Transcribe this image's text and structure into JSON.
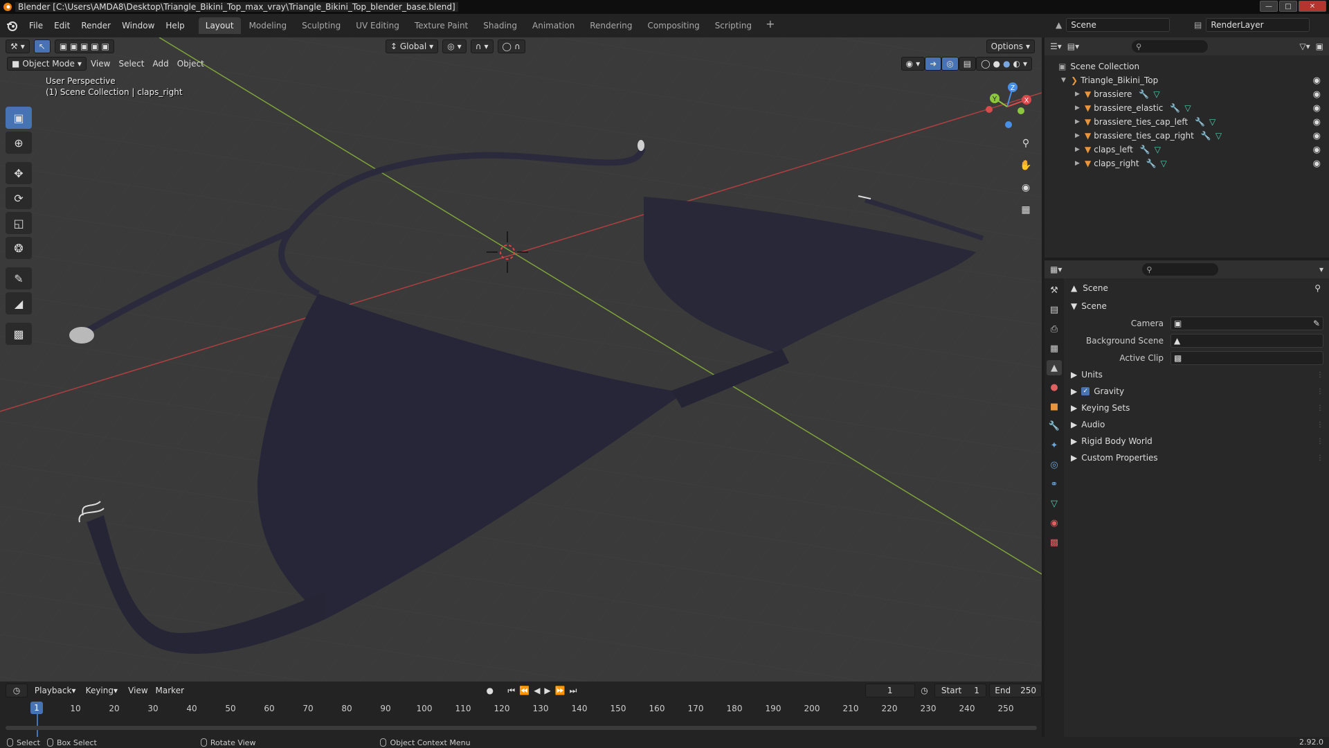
{
  "window": {
    "title": "Blender [C:\\Users\\AMDA8\\Desktop\\Triangle_Bikini_Top_max_vray\\Triangle_Bikini_Top_blender_base.blend]"
  },
  "menu": {
    "file": "File",
    "edit": "Edit",
    "render": "Render",
    "window": "Window",
    "help": "Help"
  },
  "workspaces": [
    {
      "label": "Layout",
      "active": true
    },
    {
      "label": "Modeling"
    },
    {
      "label": "Sculpting"
    },
    {
      "label": "UV Editing"
    },
    {
      "label": "Texture Paint"
    },
    {
      "label": "Shading"
    },
    {
      "label": "Animation"
    },
    {
      "label": "Rendering"
    },
    {
      "label": "Compositing"
    },
    {
      "label": "Scripting"
    }
  ],
  "scene_name": "Scene",
  "view_layer": "RenderLayer",
  "viewport": {
    "transform_orientation": "Global",
    "options_label": "Options",
    "mode": "Object Mode",
    "menus": {
      "view": "View",
      "select": "Select",
      "add": "Add",
      "object": "Object"
    },
    "perspective_label": "User Perspective",
    "collection_label": "(1) Scene Collection | claps_right",
    "gizmo": {
      "x": "X",
      "y": "Y",
      "z": "Z"
    }
  },
  "outliner": {
    "root": "Scene Collection",
    "collection": "Triangle_Bikini_Top",
    "objects": [
      {
        "name": "brassiere"
      },
      {
        "name": "brassiere_elastic"
      },
      {
        "name": "brassiere_ties_cap_left"
      },
      {
        "name": "brassiere_ties_cap_right"
      },
      {
        "name": "claps_left"
      },
      {
        "name": "claps_right"
      }
    ]
  },
  "properties": {
    "context": "Scene",
    "panel": "Scene",
    "camera_label": "Camera",
    "background_scene_label": "Background Scene",
    "active_clip_label": "Active Clip",
    "subpanels": {
      "units": "Units",
      "gravity": "Gravity",
      "keying_sets": "Keying Sets",
      "audio": "Audio",
      "rigid_body": "Rigid Body World",
      "custom_props": "Custom Properties"
    }
  },
  "timeline": {
    "playback": "Playback",
    "keying": "Keying",
    "view": "View",
    "marker": "Marker",
    "current_frame": "1",
    "start_label": "Start",
    "start": "1",
    "end_label": "End",
    "end": "250",
    "ruler": [
      "10",
      "20",
      "30",
      "40",
      "50",
      "60",
      "70",
      "80",
      "90",
      "100",
      "110",
      "120",
      "130",
      "140",
      "150",
      "160",
      "170",
      "180",
      "190",
      "200",
      "210",
      "220",
      "230",
      "240",
      "250"
    ],
    "marker_frame": "1"
  },
  "status": {
    "select": "Select",
    "box_select": "Box Select",
    "rotate_view": "Rotate View",
    "context_menu": "Object Context Menu",
    "version": "2.92.0"
  },
  "colors": {
    "accent": "#4772b3",
    "x_axis": "#d94a4a",
    "y_axis": "#8cc63f",
    "z_axis": "#4a8fe6",
    "object_icon": "#e8953e",
    "fabric": "#272638"
  }
}
